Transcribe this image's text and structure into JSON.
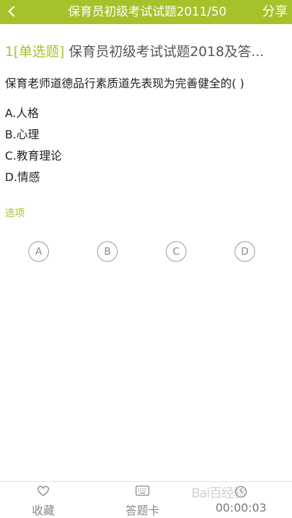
{
  "header": {
    "title": "保育员初级考试试题2011/50",
    "share_label": "分享"
  },
  "question": {
    "number": "1",
    "type_tag": "[单选题]",
    "source_title": "保育员初级考试试题2018及答...",
    "text": "保育老师道德品行素质道先表现为完善健全的( )",
    "options": [
      "A.人格",
      "B.心理",
      "C.教育理论",
      "D.情感"
    ]
  },
  "answer_section": {
    "label": "选项",
    "choices": [
      "A",
      "B",
      "C",
      "D"
    ]
  },
  "footer": {
    "favorite_label": "收藏",
    "answer_card_label": "答题卡",
    "timer": "00:00:03"
  },
  "watermark": "Bai百经验",
  "colors": {
    "accent": "#a6c22a",
    "text": "#222222",
    "muted": "#888888"
  }
}
